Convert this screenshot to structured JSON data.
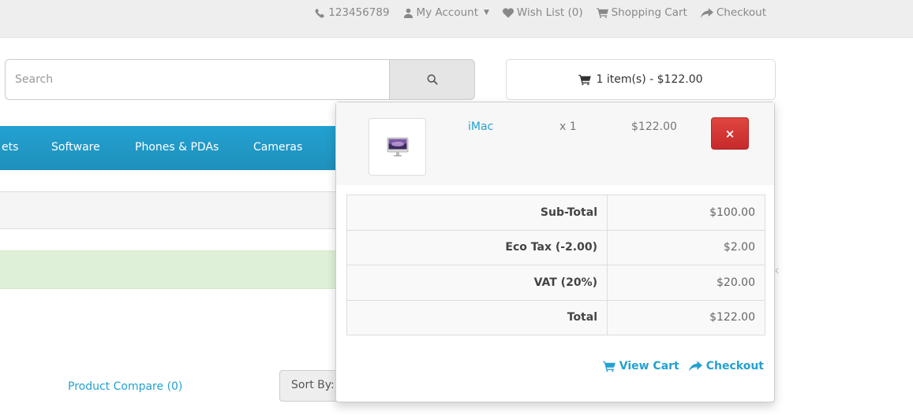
{
  "topbar": {
    "phone": "123456789",
    "my_account": "My Account",
    "wish_list": "Wish List (0)",
    "shopping_cart": "Shopping Cart",
    "checkout": "Checkout"
  },
  "search": {
    "placeholder": "Search"
  },
  "cart": {
    "summary": "1 item(s) - $122.00"
  },
  "menu": {
    "items": [
      "ets",
      "Software",
      "Phones & PDAs",
      "Cameras"
    ]
  },
  "dropdown": {
    "item": {
      "name": "iMac",
      "qty": "x 1",
      "price": "$122.00",
      "remove": "×"
    },
    "totals": [
      {
        "label": "Sub-Total",
        "value": "$100.00"
      },
      {
        "label": "Eco Tax (-2.00)",
        "value": "$2.00"
      },
      {
        "label": "VAT (20%)",
        "value": "$20.00"
      },
      {
        "label": "Total",
        "value": "$122.00"
      }
    ],
    "view_cart": "View Cart",
    "checkout": "Checkout"
  },
  "product_compare": "Product Compare (0)",
  "sort_by": "Sort By:",
  "colors": {
    "accent": "#23a1d1",
    "danger": "#d9363e",
    "alert_bg": "#dff0d8"
  }
}
